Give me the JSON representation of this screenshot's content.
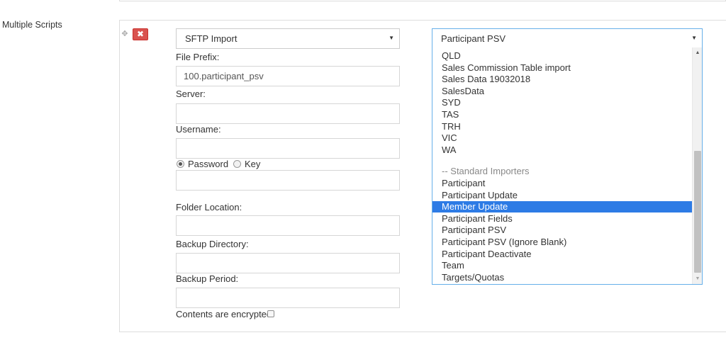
{
  "section": {
    "label": "Multiple Scripts"
  },
  "script_type": {
    "value": "SFTP Import"
  },
  "fields": {
    "file_prefix": {
      "label": "File Prefix:",
      "value": "100.participant_psv"
    },
    "server": {
      "label": "Server:",
      "value": ""
    },
    "username": {
      "label": "Username:",
      "value": ""
    },
    "auth": {
      "password_label": "Password",
      "key_label": "Key",
      "selected": "Password",
      "value": ""
    },
    "folder_location": {
      "label": "Folder Location:",
      "value": ""
    },
    "backup_directory": {
      "label": "Backup Directory:",
      "value": ""
    },
    "backup_period": {
      "label": "Backup Period:",
      "value": ""
    },
    "encrypted": {
      "label": "Contents are encrypted",
      "checked": false
    }
  },
  "importer": {
    "value": "Participant PSV",
    "options": [
      {
        "label": "QLD"
      },
      {
        "label": "Sales Commission Table import"
      },
      {
        "label": "Sales Data 19032018"
      },
      {
        "label": "SalesData"
      },
      {
        "label": "SYD"
      },
      {
        "label": "TAS"
      },
      {
        "label": "TRH"
      },
      {
        "label": "VIC"
      },
      {
        "label": "WA"
      },
      {
        "label": ""
      },
      {
        "label": "-- Standard Importers"
      },
      {
        "label": "Participant"
      },
      {
        "label": "Participant Update"
      },
      {
        "label": "Member Update"
      },
      {
        "label": "Participant Fields"
      },
      {
        "label": "Participant PSV"
      },
      {
        "label": "Participant PSV (Ignore Blank)"
      },
      {
        "label": "Participant Deactivate"
      },
      {
        "label": "Team"
      },
      {
        "label": "Targets/Quotas"
      }
    ],
    "highlighted": "Member Update"
  },
  "icons": {
    "move": "move-icon",
    "remove": "close-icon",
    "caret": "caret-down-icon",
    "scroll_up": "scroll-up-arrow-icon",
    "scroll_down": "scroll-down-arrow-icon"
  },
  "colors": {
    "remove_button": "#d9534f",
    "highlight": "#2d7be5",
    "focus_border": "#66afe9"
  }
}
